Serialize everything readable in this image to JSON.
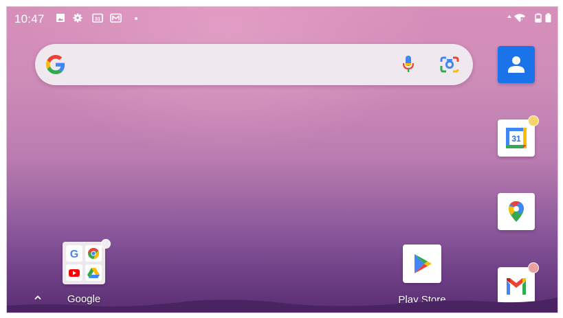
{
  "status_bar": {
    "time": "10:47",
    "left_icons": [
      "image-icon",
      "gear-icon",
      "calendar-31-icon",
      "gallery-icon",
      "dot-icon"
    ],
    "right_icons": [
      "data-arrow-icon",
      "wifi-icon",
      "battery-saver-icon",
      "battery-icon"
    ]
  },
  "search_bar": {
    "logo": "google-g-icon",
    "voice_icon": "microphone-icon",
    "lens_icon": "google-lens-icon"
  },
  "dock": [
    {
      "name": "Contacts",
      "icon": "contacts-icon",
      "color": "#1a73e8",
      "notification": false
    },
    {
      "name": "Calendar",
      "icon": "calendar-31-icon",
      "notification": true,
      "dot_color": "#f8d56b"
    },
    {
      "name": "Maps",
      "icon": "maps-pin-icon",
      "notification": false
    },
    {
      "name": "Gmail",
      "icon": "gmail-icon",
      "notification": true,
      "dot_color": "#e8a3a0"
    }
  ],
  "folder": {
    "label": "Google",
    "apps": [
      "google-icon",
      "chrome-icon",
      "youtube-icon",
      "drive-icon"
    ],
    "notification": true
  },
  "apps": [
    {
      "label": "Play Store",
      "icon": "play-store-icon"
    }
  ],
  "colors": {
    "accent_blue": "#1a73e8",
    "google_red": "#ea4335",
    "google_yellow": "#fbbc04",
    "google_green": "#34a853"
  }
}
